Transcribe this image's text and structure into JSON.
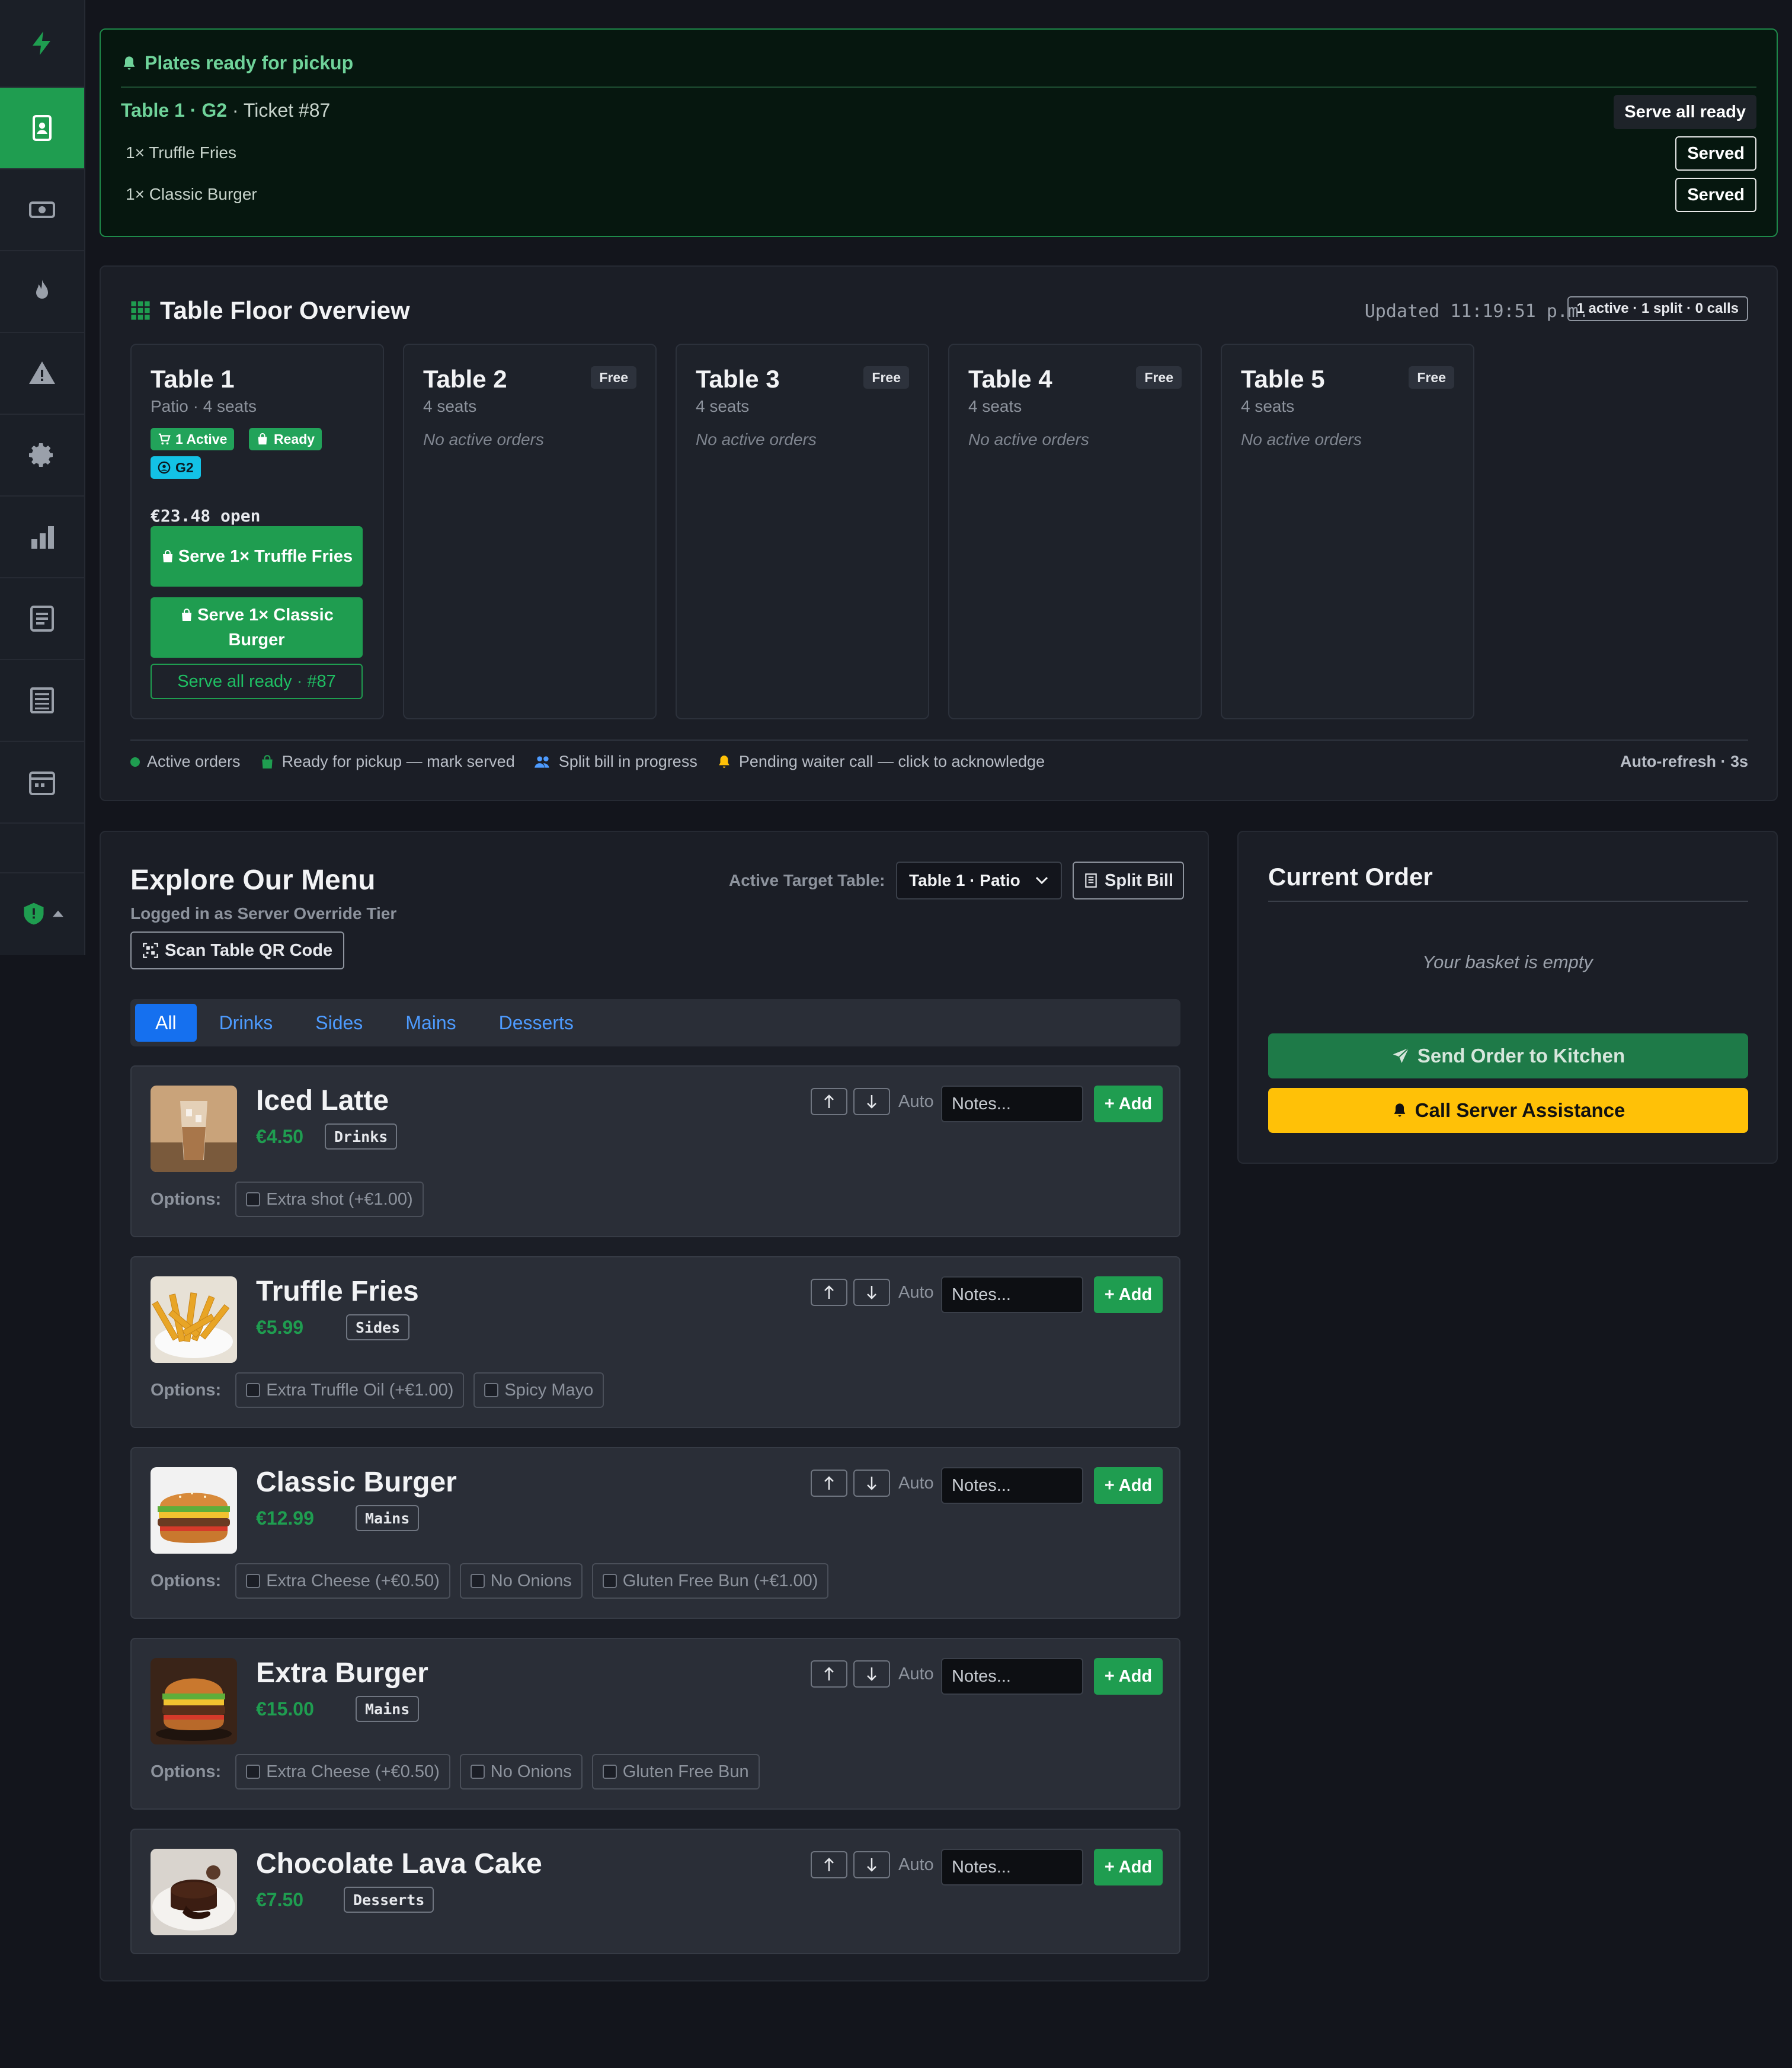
{
  "colors": {
    "accent_green": "#1f9d50",
    "accent_blue": "#1570ef",
    "accent_yellow": "#ffc107",
    "accent_cyan": "#13c2e6",
    "background": "#13151c",
    "panel": "#1b1e26"
  },
  "sidebar": {
    "items": [
      {
        "icon": "lightning-icon"
      },
      {
        "icon": "server-badge-icon",
        "active": true
      },
      {
        "icon": "cash-icon"
      },
      {
        "icon": "flame-icon"
      },
      {
        "icon": "warning-icon"
      },
      {
        "icon": "gear-icon"
      },
      {
        "icon": "bar-chart-icon"
      },
      {
        "icon": "receipt-list-icon"
      },
      {
        "icon": "menu-list-icon"
      },
      {
        "icon": "calendar-icon"
      }
    ],
    "footer_icon": "shield-icon"
  },
  "pickup": {
    "title": "Plates ready for pickup",
    "ticket_table": "Table 1 · G2",
    "ticket_number": "· Ticket #87",
    "serve_all_label": "Serve all ready",
    "lines": [
      {
        "text": "1× Truffle Fries",
        "button": "Served"
      },
      {
        "text": "1× Classic Burger",
        "button": "Served"
      }
    ]
  },
  "floor": {
    "title": "Table Floor Overview",
    "updated": "Updated 11:19:51 p.m.",
    "summary": "1 active · 1 split · 0 calls",
    "table1": {
      "name": "Table 1",
      "sub": "Patio · 4 seats",
      "badge_active": "1 Active",
      "badge_ready": "Ready",
      "badge_guest": "G2",
      "open_amount": "€23.48 open",
      "serve_btn_1": "Serve 1× Truffle Fries",
      "serve_btn_2": "Serve 1× Classic Burger",
      "serve_all": "Serve all ready · #87"
    },
    "tables": [
      {
        "name": "Table 2",
        "sub": "4 seats",
        "status": "Free",
        "note": "No active orders"
      },
      {
        "name": "Table 3",
        "sub": "4 seats",
        "status": "Free",
        "note": "No active orders"
      },
      {
        "name": "Table 4",
        "sub": "4 seats",
        "status": "Free",
        "note": "No active orders"
      },
      {
        "name": "Table 5",
        "sub": "4 seats",
        "status": "Free",
        "note": "No active orders"
      }
    ],
    "legend": {
      "active": "Active orders",
      "ready": "Ready for pickup — mark served",
      "split": "Split bill in progress",
      "call": "Pending waiter call — click to acknowledge",
      "autorefresh": "Auto-refresh · 3s"
    }
  },
  "menu": {
    "title": "Explore Our Menu",
    "logged_in": "Logged in as Server Override Tier",
    "scan_label": "Scan Table QR Code",
    "target_label": "Active Target Table:",
    "target_value": "Table 1 · Patio",
    "split_label": "Split Bill",
    "tabs": [
      "All",
      "Drinks",
      "Sides",
      "Mains",
      "Desserts"
    ],
    "active_tab": "All",
    "auto_label": "Auto",
    "notes_placeholder": "Notes...",
    "add_label": "+ Add",
    "options_label": "Options:",
    "items": [
      {
        "name": "Iced Latte",
        "price": "€4.50",
        "category": "Drinks",
        "options": [
          "Extra shot (+€1.00)"
        ]
      },
      {
        "name": "Truffle Fries",
        "price": "€5.99",
        "category": "Sides",
        "options": [
          "Extra Truffle Oil (+€1.00)",
          "Spicy Mayo"
        ]
      },
      {
        "name": "Classic Burger",
        "price": "€12.99",
        "category": "Mains",
        "options": [
          "Extra Cheese (+€0.50)",
          "No Onions",
          "Gluten Free Bun (+€1.00)"
        ]
      },
      {
        "name": "Extra Burger",
        "price": "€15.00",
        "category": "Mains",
        "options": [
          "Extra Cheese (+€0.50)",
          "No Onions",
          "Gluten Free Bun"
        ]
      },
      {
        "name": "Chocolate Lava Cake",
        "price": "€7.50",
        "category": "Desserts",
        "options": []
      }
    ]
  },
  "order": {
    "title": "Current Order",
    "empty": "Your basket is empty",
    "send_label": "Send Order to Kitchen",
    "call_label": "Call Server Assistance"
  }
}
